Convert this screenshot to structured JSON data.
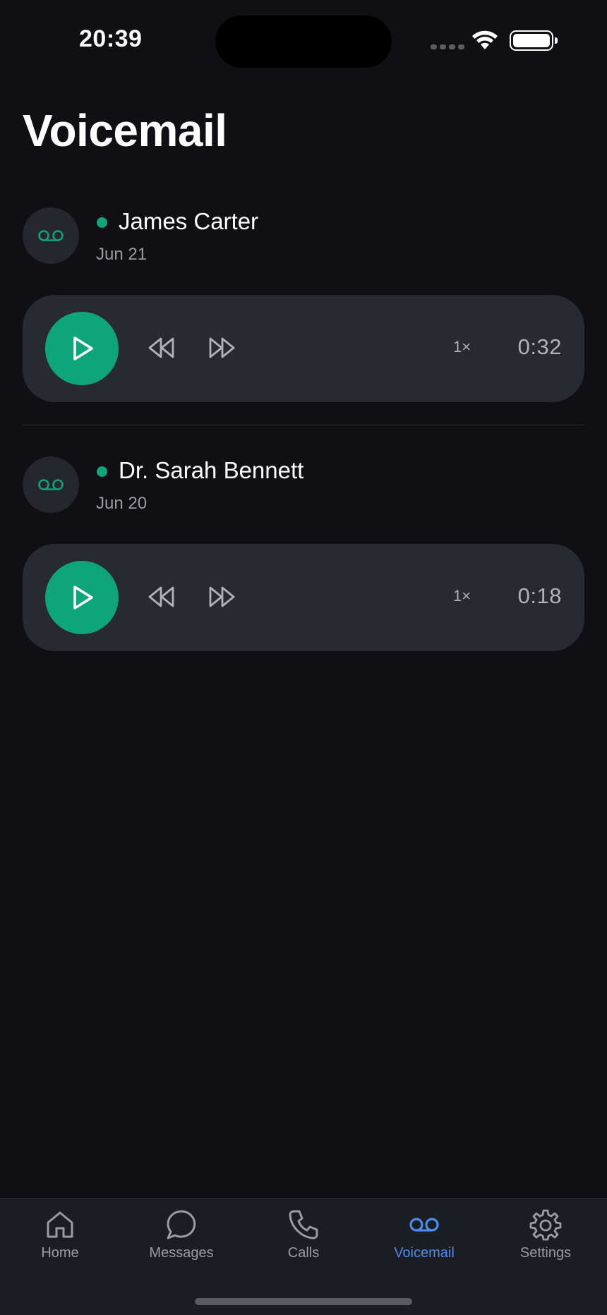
{
  "status_bar": {
    "time": "20:39"
  },
  "page": {
    "title": "Voicemail"
  },
  "colors": {
    "accent": "#0fa57a",
    "active_tab": "#4a8cf0",
    "background": "#0f0f14",
    "card": "#282a31"
  },
  "voicemails": [
    {
      "name": "James Carter",
      "date": "Jun 21",
      "speed": "1×",
      "duration": "0:32",
      "unread": true
    },
    {
      "name": "Dr. Sarah Bennett",
      "date": "Jun 20",
      "speed": "1×",
      "duration": "0:18",
      "unread": true
    }
  ],
  "tab_bar": {
    "tabs": [
      {
        "label": "Home",
        "icon": "home-icon"
      },
      {
        "label": "Messages",
        "icon": "message-icon"
      },
      {
        "label": "Calls",
        "icon": "phone-icon"
      },
      {
        "label": "Voicemail",
        "icon": "voicemail-icon",
        "active": true
      },
      {
        "label": "Settings",
        "icon": "gear-icon"
      }
    ]
  }
}
